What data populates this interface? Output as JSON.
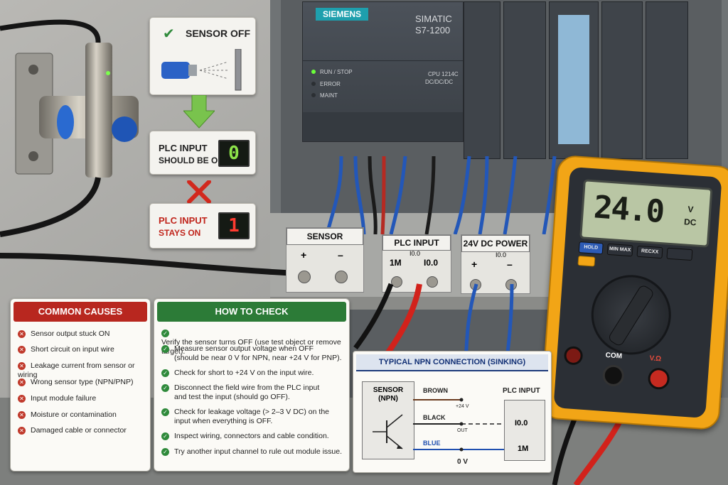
{
  "plc": {
    "brand": "SIEMENS",
    "model_line1": "SIMATIC",
    "model_line2": "S7-1200",
    "leds": [
      "RUN / STOP",
      "ERROR",
      "MAINT"
    ],
    "cpu_line1": "CPU 1214C",
    "cpu_line2": "DC/DC/DC"
  },
  "flow": {
    "sensor_off": "SENSOR OFF",
    "should_line1": "PLC INPUT",
    "should_line2": "SHOULD BE OFF",
    "should_value": "0",
    "stays_line1": "PLC INPUT",
    "stays_line2": "STAYS ON",
    "stays_value": "1"
  },
  "terminals": {
    "sensor": {
      "title": "SENSOR",
      "plus": "+",
      "minus": "–"
    },
    "plc_input": {
      "title": "PLC INPUT",
      "sub": "I0.0",
      "left": "1M",
      "right": "I0.0"
    },
    "power": {
      "title": "24V DC POWER",
      "sub": "I0.0",
      "plus": "+",
      "minus": "–"
    }
  },
  "multimeter": {
    "reading": "24.0",
    "unit_top": "V",
    "unit_bottom": "DC",
    "buttons": [
      "HOLD",
      "MIN MAX",
      "RECXX"
    ],
    "com": "COM",
    "vohm": "V.Ω",
    "colors": {
      "body": "#f2a516",
      "lcd": "#b9c6a4"
    }
  },
  "causes": {
    "title": "COMMON CAUSES",
    "color": "#b8271f",
    "items": [
      "Sensor output stuck ON",
      "Short circuit on input wire",
      "Leakage current from sensor or wiring",
      "Wrong sensor type (NPN/PNP)",
      "Input module failure",
      "Moisture or contamination",
      "Damaged cable or connector"
    ]
  },
  "check": {
    "title": "HOW TO CHECK",
    "color": "#2c7b37",
    "items": [
      [
        "Verify the sensor turns OFF (use test object or remove target)."
      ],
      [
        "Measure sensor output voltage when OFF",
        "(should be near 0 V for NPN, near +24 V for PNP)."
      ],
      [
        "Check for short to +24 V on the input wire."
      ],
      [
        "Disconnect the field wire from the PLC input",
        "and test the input (should go OFF)."
      ],
      [
        "Check for leakage voltage (> 2–3 V DC) on the",
        "input when everything is OFF."
      ],
      [
        "Inspect wiring, connectors and cable condition."
      ],
      [
        "Try another input channel to rule out module issue."
      ]
    ]
  },
  "npn": {
    "title": "TYPICAL NPN CONNECTION (SINKING)",
    "sensor_line1": "SENSOR",
    "sensor_line2": "(NPN)",
    "brown": "BROWN",
    "plus24": "+24 V",
    "black": "BLACK",
    "out": "OUT",
    "blue": "BLUE",
    "zero": "0 V",
    "plc_title": "PLC INPUT",
    "plc_i00": "I0.0",
    "plc_1m": "1M"
  }
}
